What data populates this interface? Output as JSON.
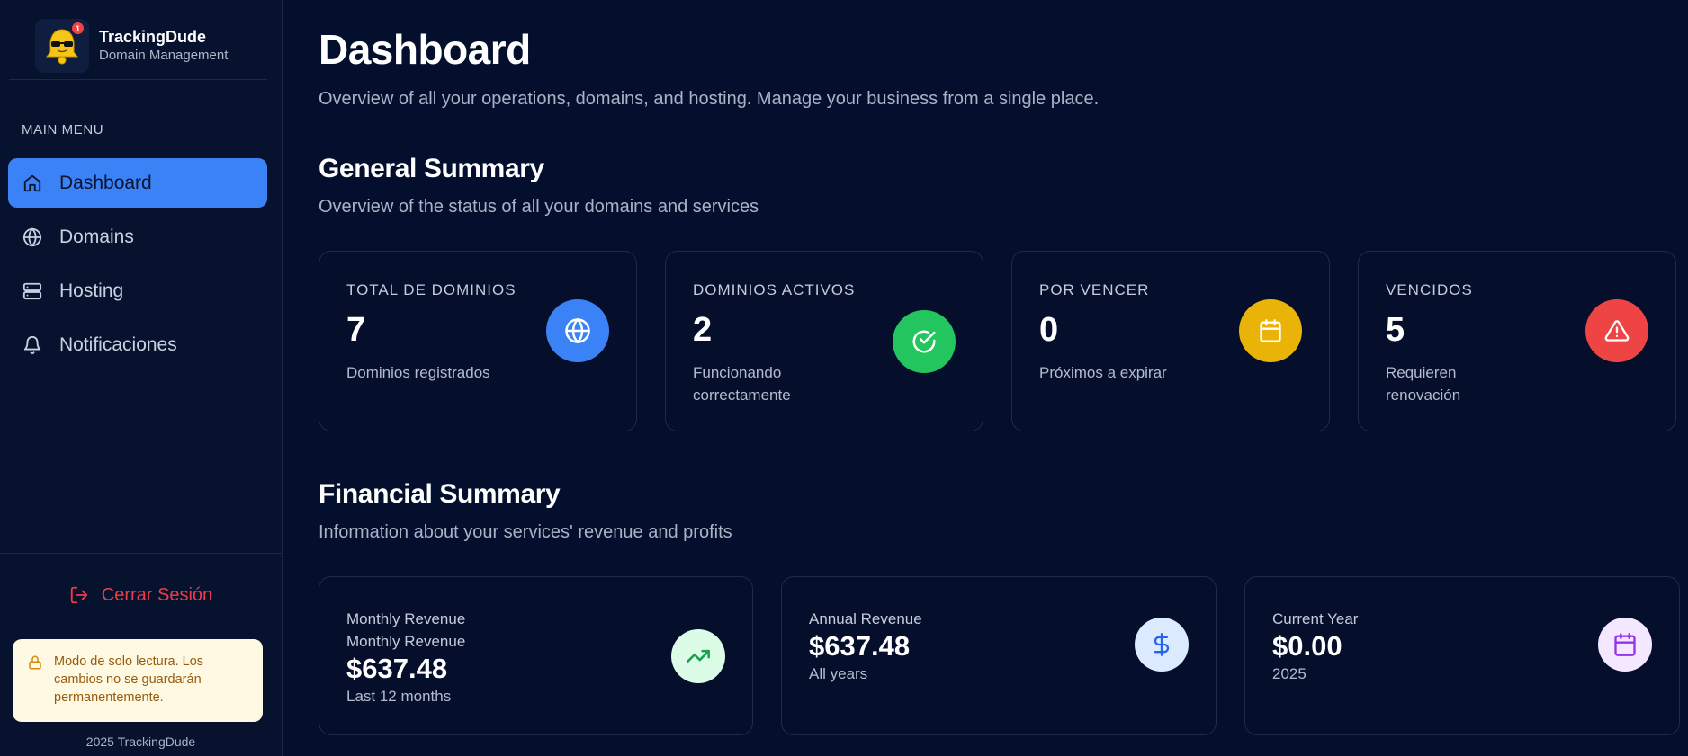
{
  "brand": {
    "name": "TrackingDude",
    "subtitle": "Domain Management",
    "badge_count": "1"
  },
  "sidebar": {
    "menu_label": "MAIN MENU",
    "items": [
      {
        "label": "Dashboard",
        "icon": "home-icon",
        "active": true
      },
      {
        "label": "Domains",
        "icon": "globe-icon",
        "active": false
      },
      {
        "label": "Hosting",
        "icon": "server-icon",
        "active": false
      },
      {
        "label": "Notificaciones",
        "icon": "bell-icon",
        "active": false
      }
    ],
    "logout_label": "Cerrar Sesión",
    "readonly_notice": "Modo de solo lectura. Los cambios no se guardarán permanentemente.",
    "copyright": "2025 TrackingDude"
  },
  "page": {
    "title": "Dashboard",
    "subtitle": "Overview of all your operations, domains, and hosting. Manage your business from a single place."
  },
  "general": {
    "title": "General Summary",
    "subtitle": "Overview of the status of all your domains and services",
    "cards": [
      {
        "label": "TOTAL DE DOMINIOS",
        "value": "7",
        "desc": "Dominios registrados",
        "icon": "globe-icon",
        "color": "#3b82f6"
      },
      {
        "label": "DOMINIOS ACTIVOS",
        "value": "2",
        "desc": "Funcionando correctamente",
        "icon": "check-circle-icon",
        "color": "#22c55e"
      },
      {
        "label": "POR VENCER",
        "value": "0",
        "desc": "Próximos a expirar",
        "icon": "calendar-icon",
        "color": "#eab308"
      },
      {
        "label": "VENCIDOS",
        "value": "5",
        "desc": "Requieren renovación",
        "icon": "alert-triangle-icon",
        "color": "#ef4444"
      }
    ]
  },
  "financial": {
    "title": "Financial Summary",
    "subtitle": "Information about your services' revenue and profits",
    "cards": [
      {
        "label": "Monthly Revenue",
        "label2": "Monthly Revenue",
        "value": "$637.48",
        "desc": "Last 12 months",
        "icon": "trending-up-icon",
        "bg": "#dcfce7",
        "fg": "#16a34a"
      },
      {
        "label": "Annual Revenue",
        "value": "$637.48",
        "desc": "All years",
        "icon": "dollar-icon",
        "bg": "#dbeafe",
        "fg": "#2563eb"
      },
      {
        "label": "Current Year",
        "value": "$0.00",
        "desc": "2025",
        "icon": "calendar-icon",
        "bg": "#f3e8ff",
        "fg": "#9333ea"
      }
    ]
  }
}
